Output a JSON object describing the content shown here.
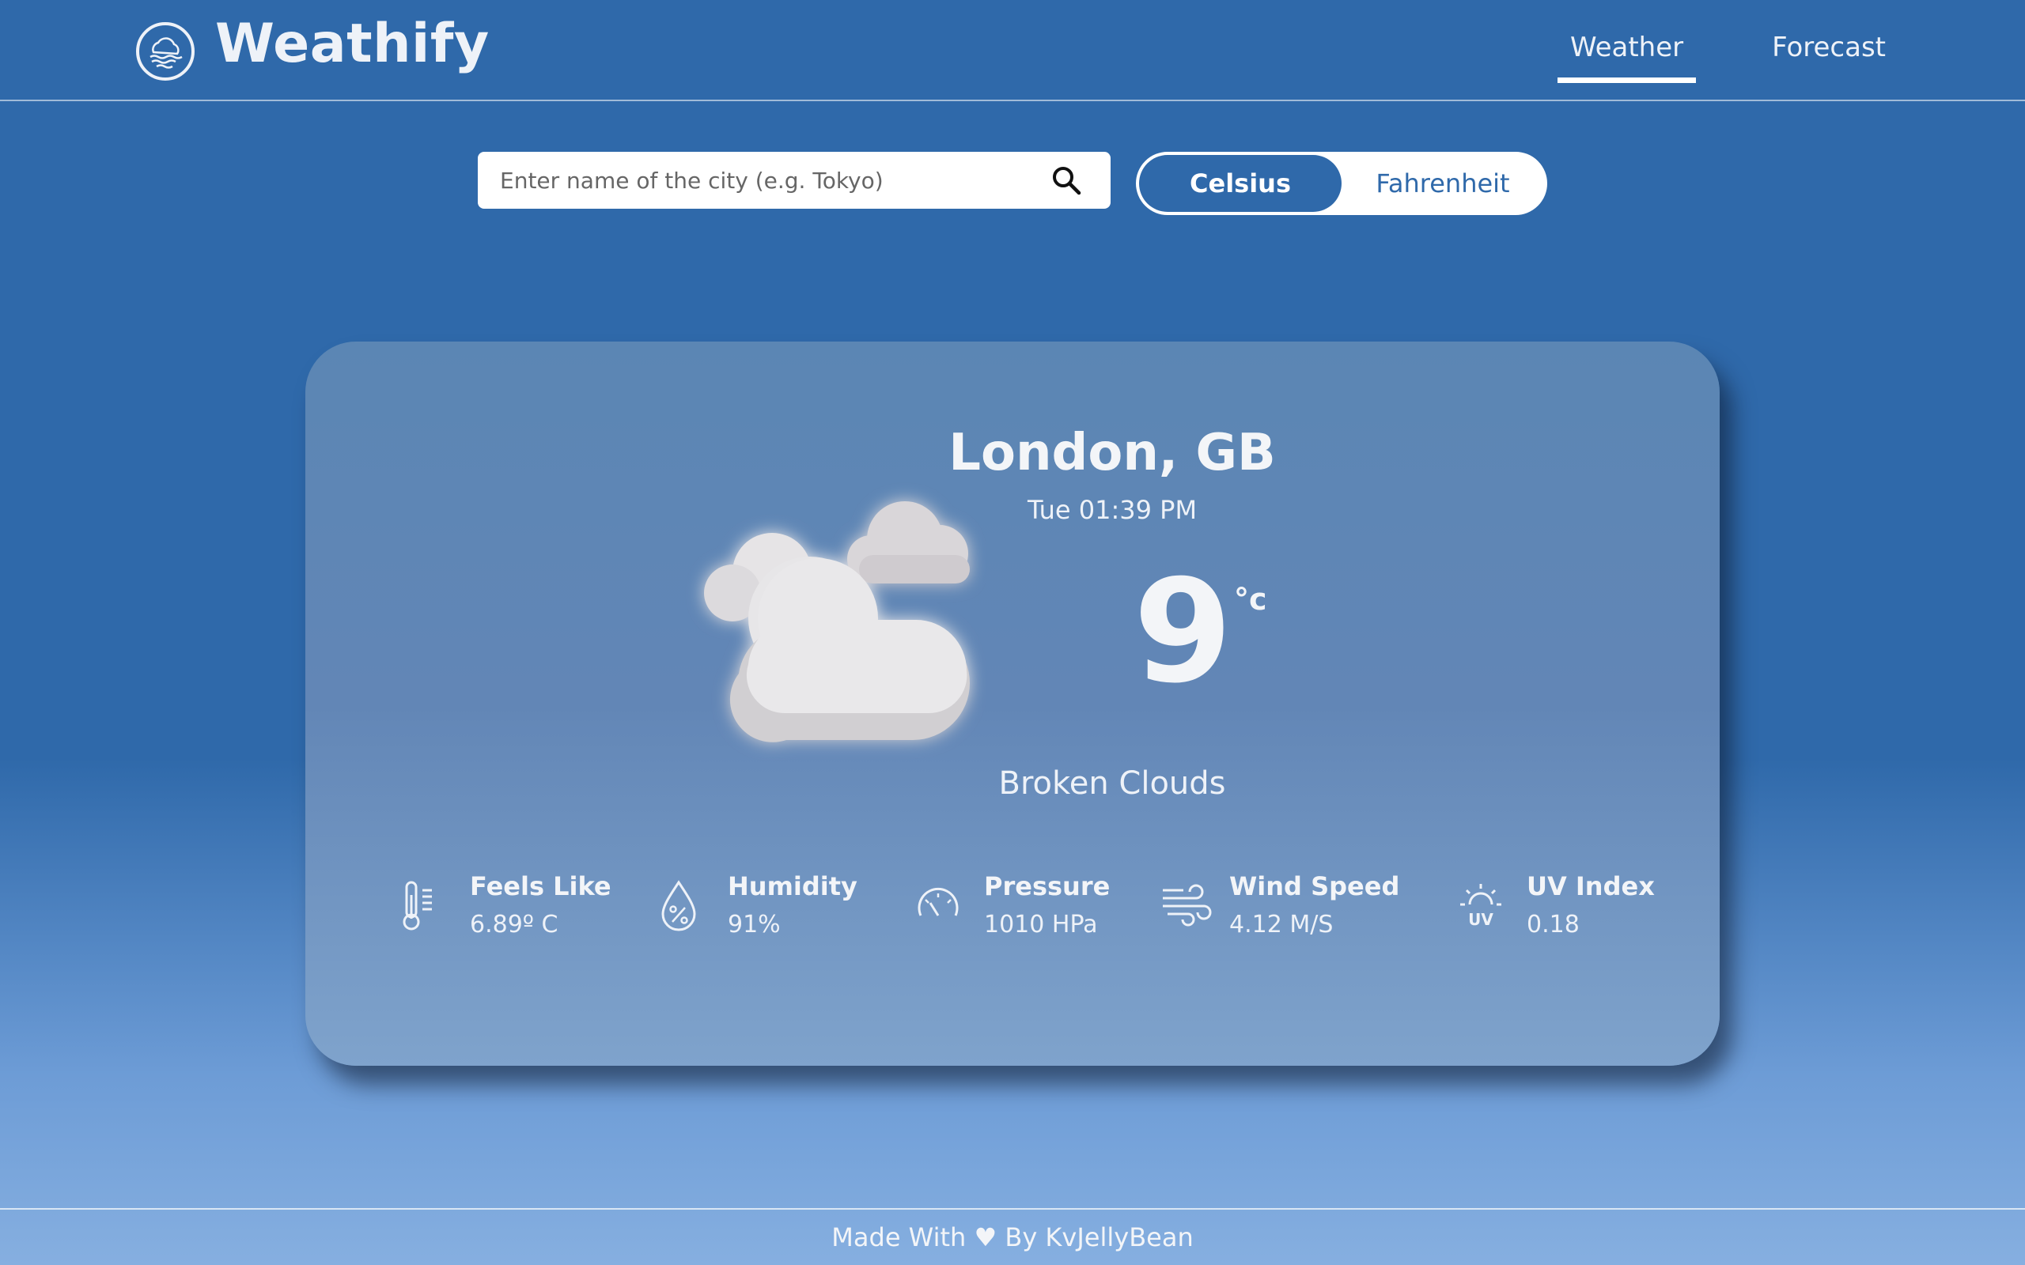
{
  "header": {
    "app_title": "Weathify",
    "nav": [
      {
        "label": "Weather",
        "active": true
      },
      {
        "label": "Forecast",
        "active": false
      }
    ]
  },
  "search": {
    "placeholder": "Enter name of the city (e.g. Tokyo)",
    "value": "",
    "icon": "search-icon"
  },
  "units": {
    "celsius_label": "Celsius",
    "fahrenheit_label": "Fahrenheit",
    "selected": "Celsius"
  },
  "weather": {
    "location": "London, GB",
    "datetime": "Tue 01:39 PM",
    "temperature": "9",
    "temp_unit": "°c",
    "description": "Broken Clouds",
    "icon": "broken-clouds-icon"
  },
  "stats": [
    {
      "label": "Feels Like",
      "value": "6.89º C",
      "icon": "thermometer-icon"
    },
    {
      "label": "Humidity",
      "value": "91%",
      "icon": "humidity-icon"
    },
    {
      "label": "Pressure",
      "value": "1010 HPa",
      "icon": "pressure-gauge-icon"
    },
    {
      "label": "Wind Speed",
      "value": "4.12 M/S",
      "icon": "wind-icon"
    },
    {
      "label": "UV Index",
      "value": "0.18",
      "icon": "uv-index-icon"
    }
  ],
  "footer": {
    "text": "Made With ♥ By KvJellyBean"
  },
  "colors": {
    "primary": "#2f69aa",
    "card": "#5b86b4",
    "text": "#eef2f8"
  }
}
